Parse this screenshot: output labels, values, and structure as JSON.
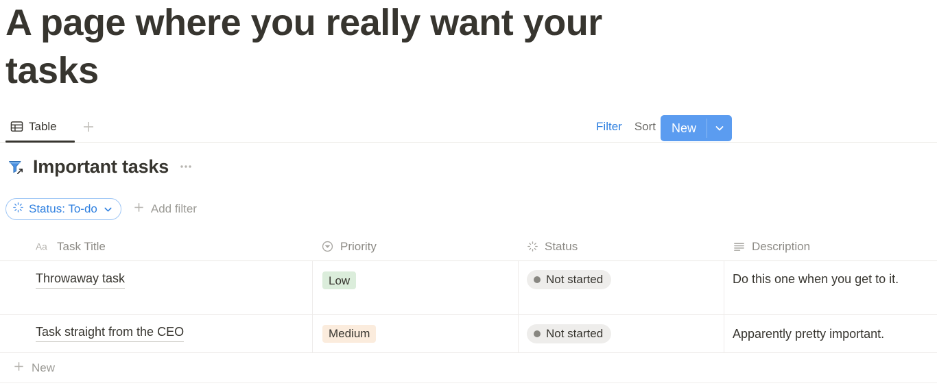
{
  "page": {
    "title": "A page where you really want your tasks"
  },
  "viewbar": {
    "tab_label": "Table",
    "tab_icon": "table-icon",
    "add_view_icon": "plus-icon",
    "filter_label": "Filter",
    "sort_label": "Sort",
    "search_icon": "search-icon",
    "expand_icon": "expand-arrows-icon",
    "more_icon": "ellipsis-icon",
    "new_label": "New",
    "new_caret_icon": "chevron-down-icon",
    "accent_blue": "#5b9cf0",
    "filter_active_color": "#2f80e0"
  },
  "database": {
    "icon": "linked-filter-funnel-icon",
    "title": "Important tasks",
    "more_icon": "ellipsis-icon"
  },
  "filters": {
    "chip": {
      "label": "Status: To-do",
      "icon": "status-spinner-icon",
      "chevron_icon": "chevron-down-icon",
      "color": "#2f80e0"
    },
    "add_filter_label": "Add filter",
    "add_filter_icon": "plus-icon"
  },
  "table": {
    "columns": [
      {
        "label": "Task Title",
        "icon": "text-aa-icon"
      },
      {
        "label": "Priority",
        "icon": "select-circle-chevron-icon"
      },
      {
        "label": "Status",
        "icon": "status-spinner-icon"
      },
      {
        "label": "Description",
        "icon": "text-lines-icon"
      }
    ],
    "rows": [
      {
        "title": "Throwaway task",
        "priority": "Low",
        "priority_color": "#dbeddb",
        "status": "Not started",
        "status_color": "#eeedeb",
        "description": "Do this one when you get to it."
      },
      {
        "title": "Task straight from the CEO",
        "priority": "Medium",
        "priority_color": "#fbecdd",
        "status": "Not started",
        "status_color": "#eeedeb",
        "description": "Apparently pretty important."
      }
    ],
    "new_row_label": "New",
    "new_row_icon": "plus-icon"
  }
}
